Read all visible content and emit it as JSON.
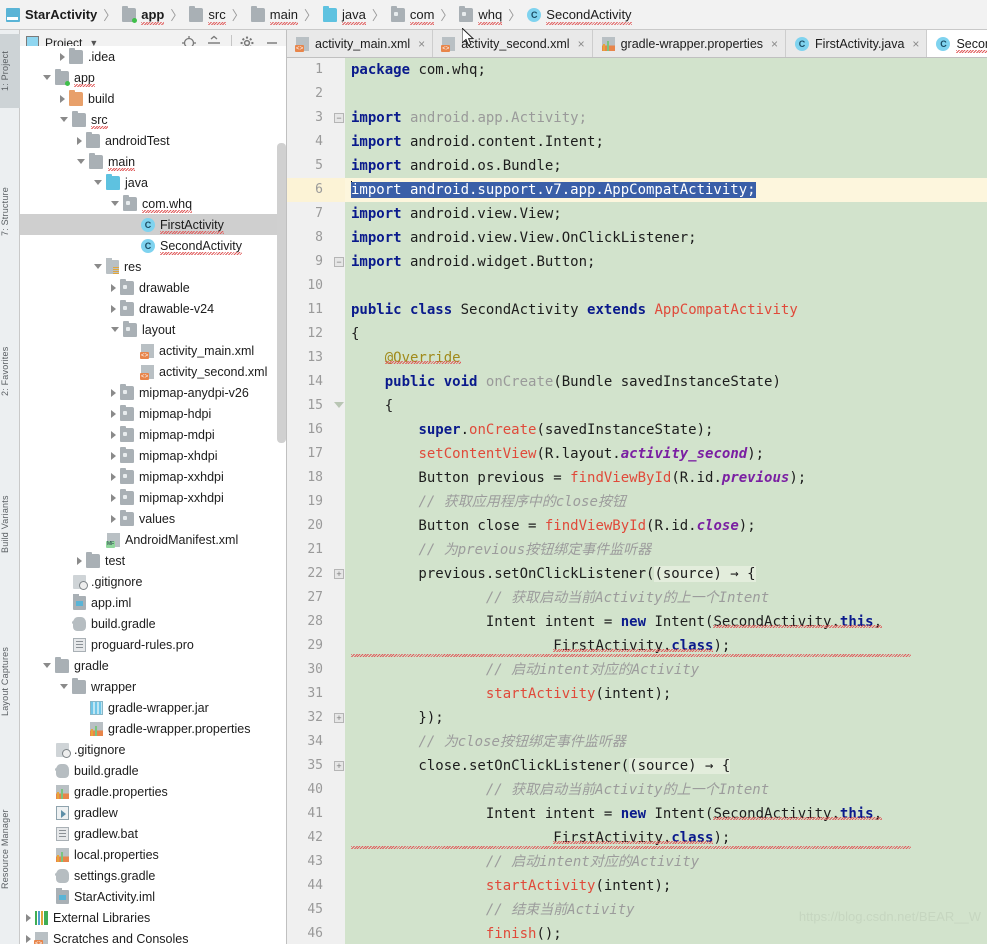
{
  "breadcrumb": {
    "items": [
      {
        "label": "StarActivity",
        "icon": "module-icon",
        "bold": true,
        "error": false
      },
      {
        "label": "app",
        "icon": "folder-module-icon",
        "bold": true,
        "error": true
      },
      {
        "label": "src",
        "icon": "folder-icon",
        "bold": false,
        "error": true
      },
      {
        "label": "main",
        "icon": "folder-icon",
        "bold": false,
        "error": true
      },
      {
        "label": "java",
        "icon": "folder-source-icon",
        "bold": false,
        "error": true
      },
      {
        "label": "com",
        "icon": "folder-package-icon",
        "bold": false,
        "error": true
      },
      {
        "label": "whq",
        "icon": "folder-package-icon",
        "bold": false,
        "error": true
      },
      {
        "label": "SecondActivity",
        "icon": "java-class-icon",
        "bold": false,
        "error": true
      }
    ],
    "separator": "〉"
  },
  "tool_strip": {
    "tabs": [
      {
        "label": "1: Project",
        "selected": true
      },
      {
        "label": "7: Structure",
        "selected": false
      },
      {
        "label": "2: Favorites",
        "selected": false
      },
      {
        "label": "Build Variants",
        "selected": false
      },
      {
        "label": "Layout Captures",
        "selected": false
      },
      {
        "label": "Resource Manager",
        "selected": false
      }
    ]
  },
  "project_panel": {
    "title": "Project",
    "dropdown_icon": "chevron-down-icon",
    "toolbar_icons": [
      {
        "name": "locate-icon"
      },
      {
        "name": "collapse-all-icon"
      },
      {
        "name": "settings-gear-icon"
      },
      {
        "name": "minimize-icon"
      }
    ],
    "tree": [
      {
        "label": ".idea",
        "indent": 2,
        "state": "closed",
        "icon": "folder-icon",
        "selected": false,
        "error": false
      },
      {
        "label": "app",
        "indent": 1,
        "state": "open",
        "icon": "folder-module-icon",
        "selected": false,
        "error": true
      },
      {
        "label": "build",
        "indent": 2,
        "state": "closed",
        "icon": "folder-orange-icon",
        "selected": false,
        "error": false
      },
      {
        "label": "src",
        "indent": 2,
        "state": "open",
        "icon": "folder-icon",
        "selected": false,
        "error": true
      },
      {
        "label": "androidTest",
        "indent": 3,
        "state": "closed",
        "icon": "folder-icon",
        "selected": false,
        "error": false
      },
      {
        "label": "main",
        "indent": 3,
        "state": "open",
        "icon": "folder-icon",
        "selected": false,
        "error": true
      },
      {
        "label": "java",
        "indent": 4,
        "state": "open",
        "icon": "folder-source-icon",
        "selected": false,
        "error": false
      },
      {
        "label": "com.whq",
        "indent": 5,
        "state": "open",
        "icon": "folder-package-icon",
        "selected": false,
        "error": true
      },
      {
        "label": "FirstActivity",
        "indent": 6,
        "state": "leaf",
        "icon": "java-class-icon",
        "selected": true,
        "error": true
      },
      {
        "label": "SecondActivity",
        "indent": 6,
        "state": "leaf",
        "icon": "java-class-icon",
        "selected": false,
        "error": true
      },
      {
        "label": "res",
        "indent": 4,
        "state": "open",
        "icon": "folder-res-icon",
        "selected": false,
        "error": false
      },
      {
        "label": "drawable",
        "indent": 5,
        "state": "closed",
        "icon": "folder-package-icon",
        "selected": false,
        "error": false
      },
      {
        "label": "drawable-v24",
        "indent": 5,
        "state": "closed",
        "icon": "folder-package-icon",
        "selected": false,
        "error": false
      },
      {
        "label": "layout",
        "indent": 5,
        "state": "open",
        "icon": "folder-package-icon",
        "selected": false,
        "error": false
      },
      {
        "label": "activity_main.xml",
        "indent": 6,
        "state": "leaf",
        "icon": "xml-file-icon",
        "selected": false,
        "error": false
      },
      {
        "label": "activity_second.xml",
        "indent": 6,
        "state": "leaf",
        "icon": "xml-file-icon",
        "selected": false,
        "error": false
      },
      {
        "label": "mipmap-anydpi-v26",
        "indent": 5,
        "state": "closed",
        "icon": "folder-package-icon",
        "selected": false,
        "error": false
      },
      {
        "label": "mipmap-hdpi",
        "indent": 5,
        "state": "closed",
        "icon": "folder-package-icon",
        "selected": false,
        "error": false
      },
      {
        "label": "mipmap-mdpi",
        "indent": 5,
        "state": "closed",
        "icon": "folder-package-icon",
        "selected": false,
        "error": false
      },
      {
        "label": "mipmap-xhdpi",
        "indent": 5,
        "state": "closed",
        "icon": "folder-package-icon",
        "selected": false,
        "error": false
      },
      {
        "label": "mipmap-xxhdpi",
        "indent": 5,
        "state": "closed",
        "icon": "folder-package-icon",
        "selected": false,
        "error": false
      },
      {
        "label": "mipmap-xxhdpi",
        "indent": 5,
        "state": "closed",
        "icon": "folder-package-icon",
        "selected": false,
        "error": false
      },
      {
        "label": "values",
        "indent": 5,
        "state": "closed",
        "icon": "folder-package-icon",
        "selected": false,
        "error": false
      },
      {
        "label": "AndroidManifest.xml",
        "indent": 4,
        "state": "leaf",
        "icon": "manifest-file-icon",
        "selected": false,
        "error": false
      },
      {
        "label": "test",
        "indent": 3,
        "state": "closed",
        "icon": "folder-icon",
        "selected": false,
        "error": false
      },
      {
        "label": ".gitignore",
        "indent": 2,
        "state": "leaf",
        "icon": "gitignore-file-icon",
        "selected": false,
        "error": false
      },
      {
        "label": "app.iml",
        "indent": 2,
        "state": "leaf",
        "icon": "iml-file-icon",
        "selected": false,
        "error": false
      },
      {
        "label": "build.gradle",
        "indent": 2,
        "state": "leaf",
        "icon": "gradle-file-icon",
        "selected": false,
        "error": false
      },
      {
        "label": "proguard-rules.pro",
        "indent": 2,
        "state": "leaf",
        "icon": "text-file-icon",
        "selected": false,
        "error": false
      },
      {
        "label": "gradle",
        "indent": 1,
        "state": "open",
        "icon": "folder-icon",
        "selected": false,
        "error": false
      },
      {
        "label": "wrapper",
        "indent": 2,
        "state": "open",
        "icon": "folder-icon",
        "selected": false,
        "error": false
      },
      {
        "label": "gradle-wrapper.jar",
        "indent": 3,
        "state": "leaf",
        "icon": "jar-file-icon",
        "selected": false,
        "error": false
      },
      {
        "label": "gradle-wrapper.properties",
        "indent": 3,
        "state": "leaf",
        "icon": "properties-file-icon",
        "selected": false,
        "error": false
      },
      {
        "label": ".gitignore",
        "indent": 1,
        "state": "leaf",
        "icon": "gitignore-file-icon",
        "selected": false,
        "error": false
      },
      {
        "label": "build.gradle",
        "indent": 1,
        "state": "leaf",
        "icon": "gradle-file-icon",
        "selected": false,
        "error": false
      },
      {
        "label": "gradle.properties",
        "indent": 1,
        "state": "leaf",
        "icon": "properties-file-icon",
        "selected": false,
        "error": false
      },
      {
        "label": "gradlew",
        "indent": 1,
        "state": "leaf",
        "icon": "executable-file-icon",
        "selected": false,
        "error": false
      },
      {
        "label": "gradlew.bat",
        "indent": 1,
        "state": "leaf",
        "icon": "text-file-icon",
        "selected": false,
        "error": false
      },
      {
        "label": "local.properties",
        "indent": 1,
        "state": "leaf",
        "icon": "properties-file-icon",
        "selected": false,
        "error": false
      },
      {
        "label": "settings.gradle",
        "indent": 1,
        "state": "leaf",
        "icon": "gradle-file-icon",
        "selected": false,
        "error": false
      },
      {
        "label": "StarActivity.iml",
        "indent": 1,
        "state": "leaf",
        "icon": "iml-file-icon",
        "selected": false,
        "error": false
      },
      {
        "label": "External Libraries",
        "indent": 0,
        "state": "closed",
        "icon": "libraries-icon",
        "selected": false,
        "error": false
      },
      {
        "label": "Scratches and Consoles",
        "indent": 0,
        "state": "closed",
        "icon": "scratches-icon",
        "selected": false,
        "error": false
      }
    ]
  },
  "editor": {
    "tabs": [
      {
        "label": "activity_main.xml",
        "icon": "xml-file-icon",
        "active": false,
        "close": "×"
      },
      {
        "label": "activity_second.xml",
        "icon": "xml-file-icon",
        "active": false,
        "close": "×"
      },
      {
        "label": "gradle-wrapper.properties",
        "icon": "properties-file-icon",
        "active": false,
        "close": "×"
      },
      {
        "label": "FirstActivity.java",
        "icon": "java-class-icon",
        "active": false,
        "close": "×"
      },
      {
        "label": "SecondActivity.java",
        "icon": "java-class-icon",
        "active": true,
        "close": "×"
      }
    ],
    "lines": [
      {
        "num": "1",
        "fold": "",
        "highlight": false
      },
      {
        "num": "2",
        "fold": "",
        "highlight": false
      },
      {
        "num": "3",
        "fold": "minus",
        "highlight": false
      },
      {
        "num": "4",
        "fold": "",
        "highlight": false
      },
      {
        "num": "5",
        "fold": "",
        "highlight": false
      },
      {
        "num": "6",
        "fold": "",
        "highlight": true
      },
      {
        "num": "7",
        "fold": "",
        "highlight": false
      },
      {
        "num": "8",
        "fold": "",
        "highlight": false
      },
      {
        "num": "9",
        "fold": "minus",
        "highlight": false
      },
      {
        "num": "10",
        "fold": "",
        "highlight": false
      },
      {
        "num": "11",
        "fold": "",
        "highlight": false
      },
      {
        "num": "12",
        "fold": "",
        "highlight": false
      },
      {
        "num": "13",
        "fold": "",
        "highlight": false
      },
      {
        "num": "14",
        "fold": "",
        "highlight": false
      },
      {
        "num": "15",
        "fold": "tri",
        "highlight": false
      },
      {
        "num": "16",
        "fold": "",
        "highlight": false
      },
      {
        "num": "17",
        "fold": "",
        "highlight": false
      },
      {
        "num": "18",
        "fold": "",
        "highlight": false
      },
      {
        "num": "19",
        "fold": "",
        "highlight": false
      },
      {
        "num": "20",
        "fold": "",
        "highlight": false
      },
      {
        "num": "21",
        "fold": "",
        "highlight": false
      },
      {
        "num": "22",
        "fold": "plus",
        "highlight": false
      },
      {
        "num": "27",
        "fold": "",
        "highlight": false
      },
      {
        "num": "28",
        "fold": "",
        "highlight": false
      },
      {
        "num": "29",
        "fold": "",
        "highlight": false
      },
      {
        "num": "30",
        "fold": "",
        "highlight": false
      },
      {
        "num": "31",
        "fold": "",
        "highlight": false
      },
      {
        "num": "32",
        "fold": "plus",
        "highlight": false
      },
      {
        "num": "34",
        "fold": "",
        "highlight": false
      },
      {
        "num": "35",
        "fold": "plus",
        "highlight": false
      },
      {
        "num": "40",
        "fold": "",
        "highlight": false
      },
      {
        "num": "41",
        "fold": "",
        "highlight": false
      },
      {
        "num": "42",
        "fold": "",
        "highlight": false
      },
      {
        "num": "43",
        "fold": "",
        "highlight": false
      },
      {
        "num": "44",
        "fold": "",
        "highlight": false
      },
      {
        "num": "45",
        "fold": "",
        "highlight": false
      },
      {
        "num": "46",
        "fold": "",
        "highlight": false
      }
    ],
    "source_text": [
      "package com.whq;",
      "",
      "import android.app.Activity;",
      "import android.content.Intent;",
      "import android.os.Bundle;",
      "import android.support.v7.app.AppCompatActivity;",
      "import android.view.View;",
      "import android.view.View.OnClickListener;",
      "import android.widget.Button;",
      "",
      "public class SecondActivity extends AppCompatActivity",
      "{",
      "    @Override",
      "    public void onCreate(Bundle savedInstanceState)",
      "    {",
      "        super.onCreate(savedInstanceState);",
      "        setContentView(R.layout.activity_second);",
      "        Button previous = findViewById(R.id.previous);",
      "        // 获取应用程序中的close按钮",
      "        Button close = findViewById(R.id.close);",
      "        // 为previous按钮绑定事件监听器",
      "        previous.setOnClickListener((source) → {",
      "                // 获取启动当前Activity的上一个Intent",
      "                Intent intent = new Intent(SecondActivity.this,",
      "                        FirstActivity.class);",
      "                // 启动intent对应的Activity",
      "                startActivity(intent);",
      "        });",
      "        // 为close按钮绑定事件监听器",
      "        close.setOnClickListener((source) → {",
      "                // 获取启动当前Activity的上一个Intent",
      "                Intent intent = new Intent(SecondActivity.this,",
      "                        FirstActivity.class);",
      "                // 启动intent对应的Activity",
      "                startActivity(intent);",
      "                // 结束当前Activity",
      "                finish();"
    ],
    "selection": {
      "line": "6",
      "text": "import android.support.v7.app.AppCompatActivity;",
      "background_color": "#3a5fa8",
      "foreground_color": "#ffffff"
    },
    "caret_line": "6"
  },
  "watermark": "https://blog.csdn.net/BEAR__W",
  "colors": {
    "code_background": "#d2e3cc",
    "gutter_background": "#f0f0f0",
    "highlight_line": "#fdf6dd",
    "selection": "#3a5fa8",
    "keyword": "#0a1a8c",
    "class_name": "#e04a3a",
    "method": "#e04a3a",
    "field": "#7a1fa2",
    "comment": "#9c9c9c",
    "annotation": "#a08a1a",
    "error_squiggle": "#e05c5c",
    "tree_selection": "#cfcfcf"
  }
}
